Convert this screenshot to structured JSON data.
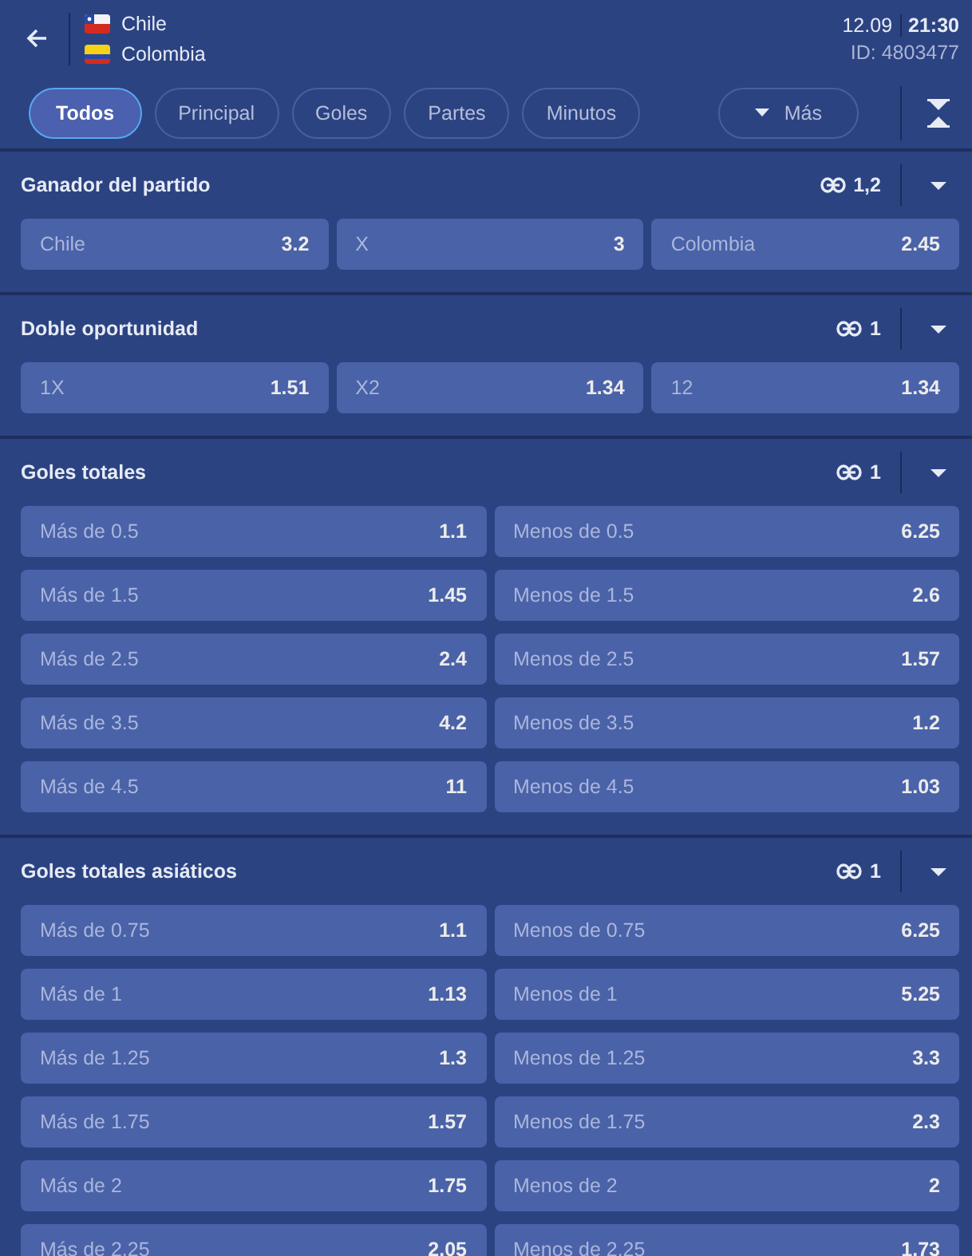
{
  "header": {
    "teams": [
      {
        "name": "Chile",
        "kind": "chile"
      },
      {
        "name": "Colombia",
        "kind": "colombia"
      }
    ],
    "date": "12.09",
    "time": "21:30",
    "match_id": "ID: 4803477"
  },
  "filters": [
    {
      "label": "Todos",
      "selected": true
    },
    {
      "label": "Principal",
      "selected": false
    },
    {
      "label": "Goles",
      "selected": false
    },
    {
      "label": "Partes",
      "selected": false
    },
    {
      "label": "Minutos",
      "selected": false
    }
  ],
  "more_button": "Más",
  "markets": [
    {
      "title": "Ganador del partido",
      "link_count": "1,2",
      "kind": "triple",
      "outcomes": [
        {
          "label": "Chile",
          "odds": "3.2"
        },
        {
          "label": "X",
          "odds": "3"
        },
        {
          "label": "Colombia",
          "odds": "2.45"
        }
      ]
    },
    {
      "title": "Doble oportunidad",
      "link_count": "1",
      "kind": "triple",
      "outcomes": [
        {
          "label": "1X",
          "odds": "1.51"
        },
        {
          "label": "X2",
          "odds": "1.34"
        },
        {
          "label": "12",
          "odds": "1.34"
        }
      ]
    },
    {
      "title": "Goles totales",
      "link_count": "1",
      "kind": "pair",
      "outcomes": [
        {
          "label": "Más de 0.5",
          "odds": "1.1"
        },
        {
          "label": "Menos de 0.5",
          "odds": "6.25"
        },
        {
          "label": "Más de 1.5",
          "odds": "1.45"
        },
        {
          "label": "Menos de 1.5",
          "odds": "2.6"
        },
        {
          "label": "Más de 2.5",
          "odds": "2.4"
        },
        {
          "label": "Menos de 2.5",
          "odds": "1.57"
        },
        {
          "label": "Más de 3.5",
          "odds": "4.2"
        },
        {
          "label": "Menos de 3.5",
          "odds": "1.2"
        },
        {
          "label": "Más de 4.5",
          "odds": "11"
        },
        {
          "label": "Menos de 4.5",
          "odds": "1.03"
        }
      ]
    },
    {
      "title": "Goles totales asiáticos",
      "link_count": "1",
      "kind": "pair",
      "outcomes": [
        {
          "label": "Más de 0.75",
          "odds": "1.1"
        },
        {
          "label": "Menos de 0.75",
          "odds": "6.25"
        },
        {
          "label": "Más de 1",
          "odds": "1.13"
        },
        {
          "label": "Menos de 1",
          "odds": "5.25"
        },
        {
          "label": "Más de 1.25",
          "odds": "1.3"
        },
        {
          "label": "Menos de 1.25",
          "odds": "3.3"
        },
        {
          "label": "Más de 1.75",
          "odds": "1.57"
        },
        {
          "label": "Menos de 1.75",
          "odds": "2.3"
        },
        {
          "label": "Más de 2",
          "odds": "1.75"
        },
        {
          "label": "Menos de 2",
          "odds": "2"
        },
        {
          "label": "Más de 2.25",
          "odds": "2.05"
        },
        {
          "label": "Menos de 2.25",
          "odds": "1.73"
        }
      ]
    }
  ]
}
